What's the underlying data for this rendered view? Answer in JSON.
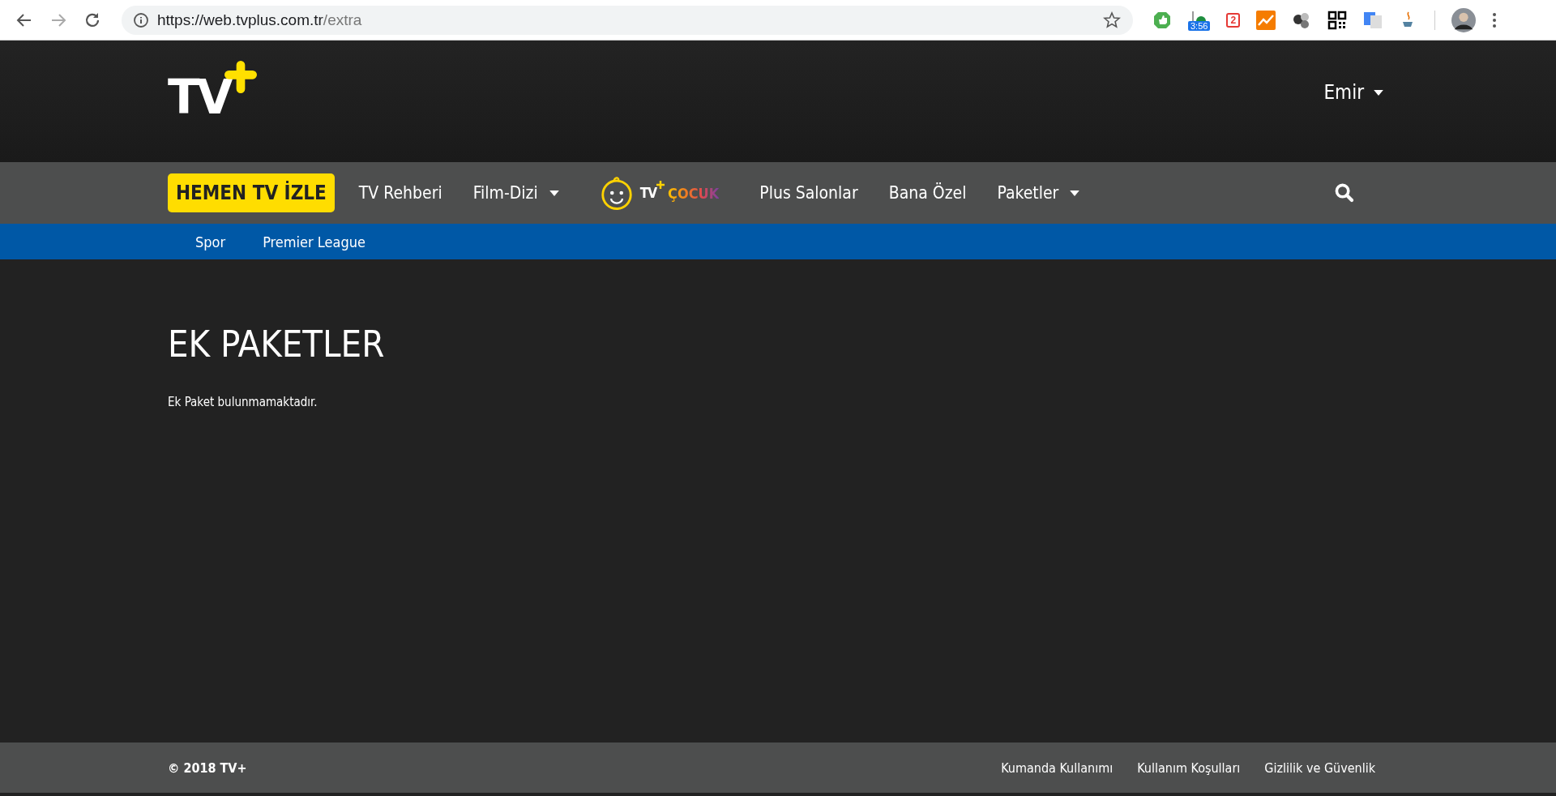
{
  "browser": {
    "url_host": "https://web.tvplus.com.tr",
    "url_path": "/extra",
    "extension_badge": "3:56",
    "tag_count": "2"
  },
  "header": {
    "logo_text": "TV",
    "user": "Emir"
  },
  "nav": {
    "cta": "HEMEN TV İZLE",
    "items": [
      {
        "label": "TV Rehberi",
        "kind": "link"
      },
      {
        "label": "Film-Dizi",
        "kind": "dropdown"
      },
      {
        "label": "ÇOCUK",
        "kind": "kids-logo",
        "logo_prefix": "TV"
      },
      {
        "label": "Plus Salonlar",
        "kind": "link"
      },
      {
        "label": "Bana Özel",
        "kind": "link"
      },
      {
        "label": "Paketler",
        "kind": "dropdown"
      }
    ]
  },
  "subnav": [
    "Spor",
    "Premier League"
  ],
  "main": {
    "title": "EK PAKETLER",
    "message": "Ek Paket bulunmamaktadır."
  },
  "footer": {
    "copyright": "© 2018 TV+",
    "links": [
      "Kumanda Kullanımı",
      "Kullanım Koşulları",
      "Gizlilik ve Güvenlik"
    ]
  }
}
